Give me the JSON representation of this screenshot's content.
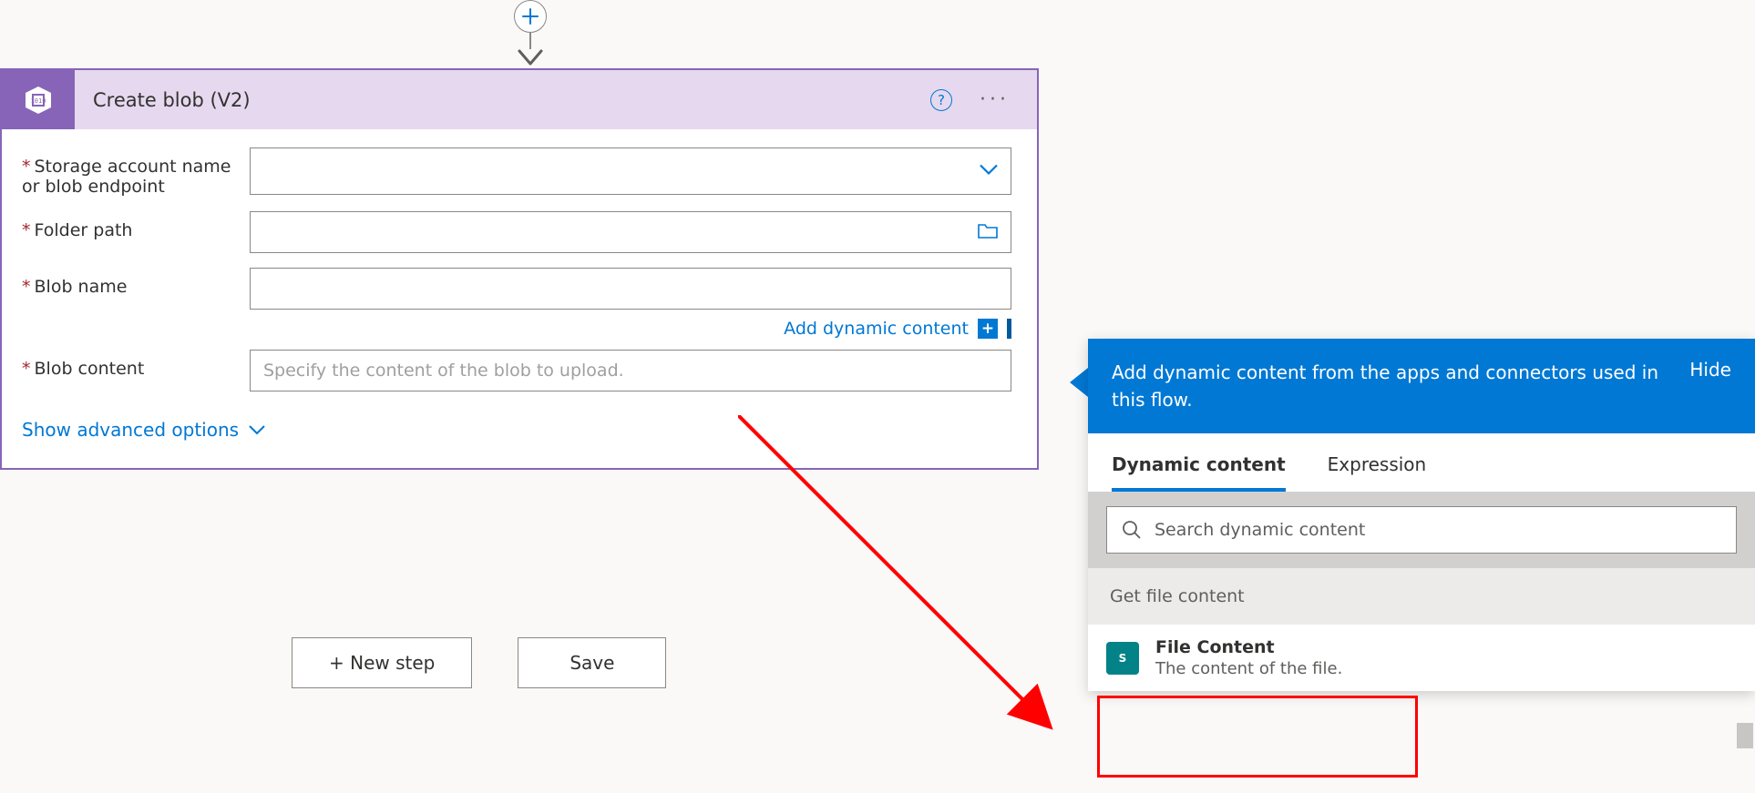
{
  "action": {
    "title": "Create blob (V2)",
    "fields": {
      "storage": {
        "label": "Storage account name or blob endpoint",
        "value": ""
      },
      "folder": {
        "label": "Folder path",
        "value": ""
      },
      "blobname": {
        "label": "Blob name",
        "value": ""
      },
      "content": {
        "label": "Blob content",
        "value": "",
        "placeholder": "Specify the content of the blob to upload."
      }
    },
    "add_dynamic": "Add dynamic content",
    "show_advanced": "Show advanced options"
  },
  "buttons": {
    "new_step": "+ New step",
    "save": "Save"
  },
  "popout": {
    "header": "Add dynamic content from the apps and connectors used in this flow.",
    "hide": "Hide",
    "tabs": {
      "dynamic": "Dynamic content",
      "expression": "Expression"
    },
    "search_placeholder": "Search dynamic content",
    "group": "Get file content",
    "item": {
      "title": "File Content",
      "subtitle": "The content of the file."
    }
  }
}
